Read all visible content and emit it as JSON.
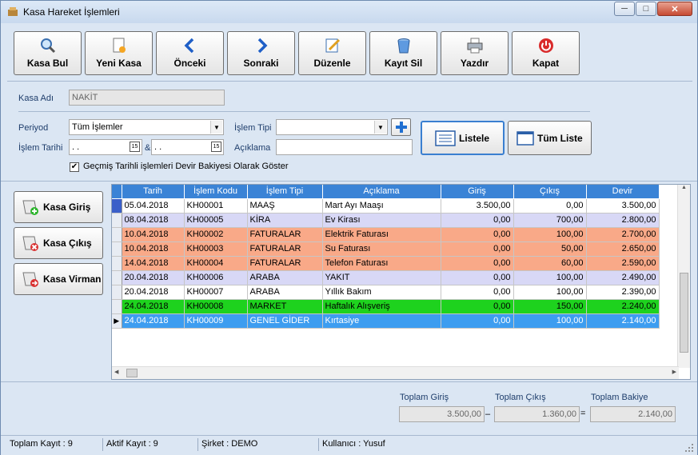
{
  "window": {
    "title": "Kasa Hareket İşlemleri"
  },
  "toolbar": {
    "buttons": [
      {
        "label": "Kasa Bul",
        "icon": "magnifier-icon"
      },
      {
        "label": "Yeni Kasa",
        "icon": "new-document-icon"
      },
      {
        "label": "Önceki",
        "icon": "chevron-left-icon"
      },
      {
        "label": "Sonraki",
        "icon": "chevron-right-icon"
      },
      {
        "label": "Düzenle",
        "icon": "edit-pencil-icon"
      },
      {
        "label": "Kayıt Sil",
        "icon": "trash-icon"
      },
      {
        "label": "Yazdır",
        "icon": "printer-icon"
      },
      {
        "label": "Kapat",
        "icon": "power-icon"
      }
    ]
  },
  "form": {
    "kasa_adi_label": "Kasa Adı",
    "kasa_adi_value": "NAKİT",
    "periyod_label": "Periyod",
    "periyod_value": "Tüm İşlemler",
    "islem_tarihi_label": "İşlem Tarihi",
    "date_from": "  .  .",
    "date_to": "  .  .",
    "amp": "&",
    "islem_tipi_label": "İşlem Tipi",
    "islem_tipi_value": "",
    "aciklama_label": "Açıklama",
    "aciklama_value": "",
    "listele_label": "Listele",
    "tum_liste_label": "Tüm Liste",
    "checkbox_label": "Geçmiş Tarihli işlemleri Devir Bakiyesi Olarak Göster",
    "checkbox_checked": true
  },
  "side": {
    "giris": "Kasa Giriş",
    "cikis": "Kasa Çıkış",
    "virman": "Kasa Virman"
  },
  "table": {
    "columns": [
      "Tarih",
      "İşlem Kodu",
      "İşlem Tipi",
      "Açıklama",
      "Giriş",
      "Çıkış",
      "Devir"
    ],
    "rows": [
      {
        "tarih": "05.04.2018",
        "kod": "KH00001",
        "tip": "MAAŞ",
        "aciklama": "Mart Ayı Maaşı",
        "giris": "3.500,00",
        "cikis": "0,00",
        "devir": "3.500,00",
        "color": "#ffffff"
      },
      {
        "tarih": "08.04.2018",
        "kod": "KH00005",
        "tip": "KİRA",
        "aciklama": "Ev Kirası",
        "giris": "0,00",
        "cikis": "700,00",
        "devir": "2.800,00",
        "color": "#d8d8f6"
      },
      {
        "tarih": "10.04.2018",
        "kod": "KH00002",
        "tip": "FATURALAR",
        "aciklama": "Elektrik Faturası",
        "giris": "0,00",
        "cikis": "100,00",
        "devir": "2.700,00",
        "color": "#f9a988"
      },
      {
        "tarih": "10.04.2018",
        "kod": "KH00003",
        "tip": "FATURALAR",
        "aciklama": "Su Faturası",
        "giris": "0,00",
        "cikis": "50,00",
        "devir": "2.650,00",
        "color": "#f9a988"
      },
      {
        "tarih": "14.04.2018",
        "kod": "KH00004",
        "tip": "FATURALAR",
        "aciklama": "Telefon Faturası",
        "giris": "0,00",
        "cikis": "60,00",
        "devir": "2.590,00",
        "color": "#f9a988"
      },
      {
        "tarih": "20.04.2018",
        "kod": "KH00006",
        "tip": "ARABA",
        "aciklama": "YAKIT",
        "giris": "0,00",
        "cikis": "100,00",
        "devir": "2.490,00",
        "color": "#d8d8f6"
      },
      {
        "tarih": "20.04.2018",
        "kod": "KH00007",
        "tip": "ARABA",
        "aciklama": "Yıllık Bakım",
        "giris": "0,00",
        "cikis": "100,00",
        "devir": "2.390,00",
        "color": "#ffffff"
      },
      {
        "tarih": "24.04.2018",
        "kod": "KH00008",
        "tip": "MARKET",
        "aciklama": "Haftalık Alışveriş",
        "giris": "0,00",
        "cikis": "150,00",
        "devir": "2.240,00",
        "color": "#1ed21e"
      },
      {
        "tarih": "24.04.2018",
        "kod": "KH00009",
        "tip": "GENEL GİDER",
        "aciklama": "Kırtasiye",
        "giris": "0,00",
        "cikis": "100,00",
        "devir": "2.140,00",
        "color": "#3d9df0",
        "selected": true
      }
    ]
  },
  "totals": {
    "giris_label": "Toplam Giriş",
    "giris": "3.500,00",
    "minus": "–",
    "cikis_label": "Toplam Çıkış",
    "cikis": "1.360,00",
    "equals": "=",
    "bakiye_label": "Toplam Bakiye",
    "bakiye": "2.140,00"
  },
  "status": {
    "toplam": "Toplam Kayıt : 9",
    "aktif": "Aktif Kayıt : 9",
    "sirket": "Şirket : DEMO",
    "kullanici": "Kullanıcı : Yusuf"
  }
}
